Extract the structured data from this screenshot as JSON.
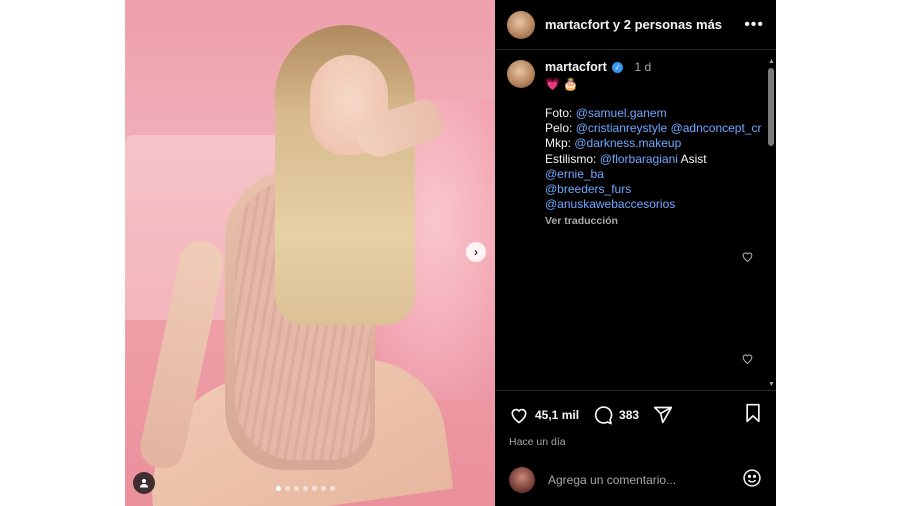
{
  "header": {
    "username": "martacfort",
    "others_text": "y 2 personas más"
  },
  "caption": {
    "username": "martacfort",
    "time": "1 d",
    "emoji": "💗 🎂",
    "credits": [
      {
        "label": "Foto:",
        "mentions": [
          "@samuel.ganem"
        ],
        "suffix": ""
      },
      {
        "label": "Pelo:",
        "mentions": [
          "@cristianreystyle",
          "@adnconcept_cr"
        ],
        "suffix": ""
      },
      {
        "label": "Mkp:",
        "mentions": [
          "@darkness.makeup"
        ],
        "suffix": ""
      },
      {
        "label": "Estilismo:",
        "mentions": [
          "@florbaragiani"
        ],
        "suffix": "Asist"
      },
      {
        "label": "",
        "mentions": [
          "@ernie_ba"
        ],
        "suffix": ""
      },
      {
        "label": "",
        "mentions": [
          "@breeders_furs",
          "@anuskawebaccesorios"
        ],
        "suffix": ""
      }
    ],
    "see_translation": "Ver traducción"
  },
  "actions": {
    "likes": "45,1 mil",
    "comments": "383",
    "posted": "Hace un día"
  },
  "comment_box": {
    "placeholder": "Agrega un comentario..."
  },
  "carousel": {
    "total_slides": 7,
    "active_slide": 1
  },
  "icons": {
    "next": "chevron-right-icon",
    "tag": "user-tag-icon",
    "more": "more-horizontal-icon",
    "verified": "verified-badge-icon",
    "like": "heart-icon",
    "comment": "comment-icon",
    "share": "send-icon",
    "save": "bookmark-icon",
    "emoji": "emoji-icon"
  },
  "colors": {
    "background": "#000000",
    "link": "#6fa8ff",
    "muted": "#a8a8a8",
    "verified": "#3897f0"
  }
}
